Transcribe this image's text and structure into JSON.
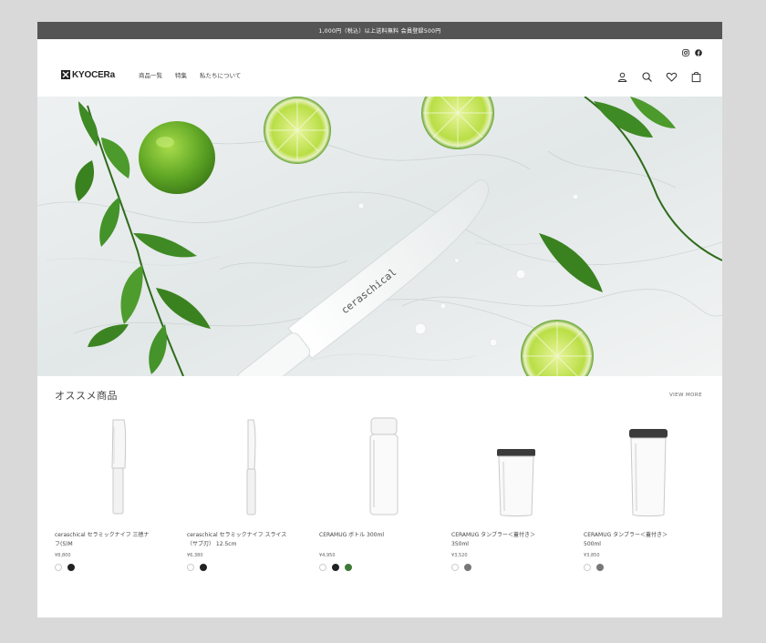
{
  "announcement": "1,000円（税込）以上送料無料 会員登録500円",
  "header": {
    "logo_text": "KYOCERa",
    "nav": [
      "商品一覧",
      "特集",
      "私たちについて"
    ],
    "icons": [
      "account-icon",
      "search-icon",
      "favorite-icon",
      "cart-icon"
    ]
  },
  "social": [
    "instagram-icon",
    "facebook-icon"
  ],
  "hero": {
    "knife_brand": "ceraschical"
  },
  "section": {
    "title": "オススメ商品",
    "view_all": "VIEW MORE"
  },
  "products": [
    {
      "name": "ceraschical セラミックナイフ 三徳ナ",
      "name2": "フ(S)M",
      "price": "¥8,800",
      "swatches": [
        "#ffffff",
        "#222222"
      ]
    },
    {
      "name": "ceraschical セラミックナイフ スライス",
      "name2": "（サブ刃） 12.5cm",
      "price": "¥6,380",
      "swatches": [
        "#ffffff",
        "#222222"
      ]
    },
    {
      "name": "CERAMUG ボトル 300ml",
      "name2": "",
      "price": "¥4,950",
      "swatches": [
        "#ffffff",
        "#222222",
        "#3d7a3a"
      ]
    },
    {
      "name": "CERAMUG タンブラー＜蓋付き＞",
      "name2": "350ml",
      "price": "¥3,520",
      "swatches": [
        "#ffffff",
        "#777777"
      ]
    },
    {
      "name": "CERAMUG タンブラー＜蓋付き＞",
      "name2": "500ml",
      "price": "¥3,850",
      "swatches": [
        "#ffffff",
        "#777777"
      ]
    }
  ]
}
